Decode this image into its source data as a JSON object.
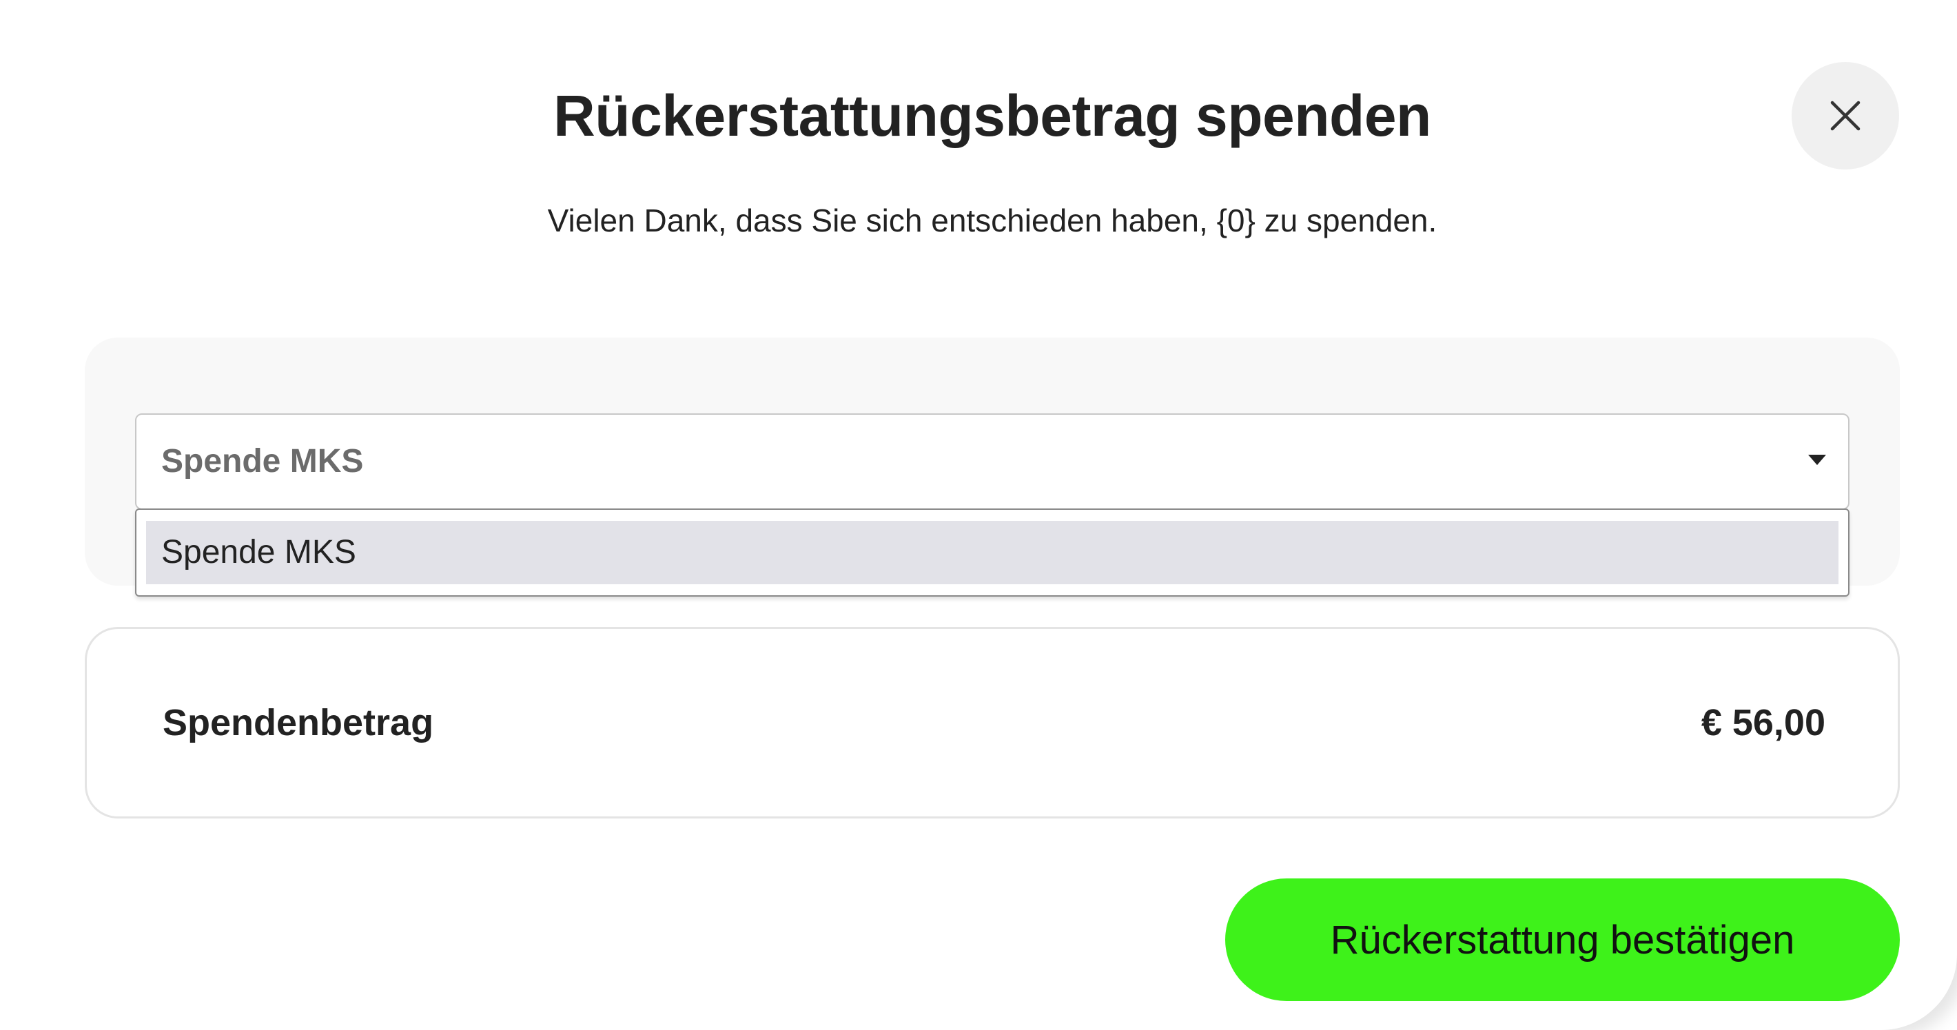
{
  "dialog": {
    "title": "Rückerstattungsbetrag spenden",
    "subtitle": "Vielen Dank, dass Sie sich entschieden haben, {0} zu spenden.",
    "close_icon": "close-icon"
  },
  "donation_select": {
    "selected_value": "Spende MKS",
    "arrow_icon": "caret-down-icon",
    "options": [
      "Spende MKS"
    ],
    "highlighted_index": 0
  },
  "amount": {
    "label": "Spendenbetrag",
    "value": "€ 56,00"
  },
  "actions": {
    "confirm_label": "Rückerstattung bestätigen",
    "confirm_color": "#3ef21a"
  }
}
